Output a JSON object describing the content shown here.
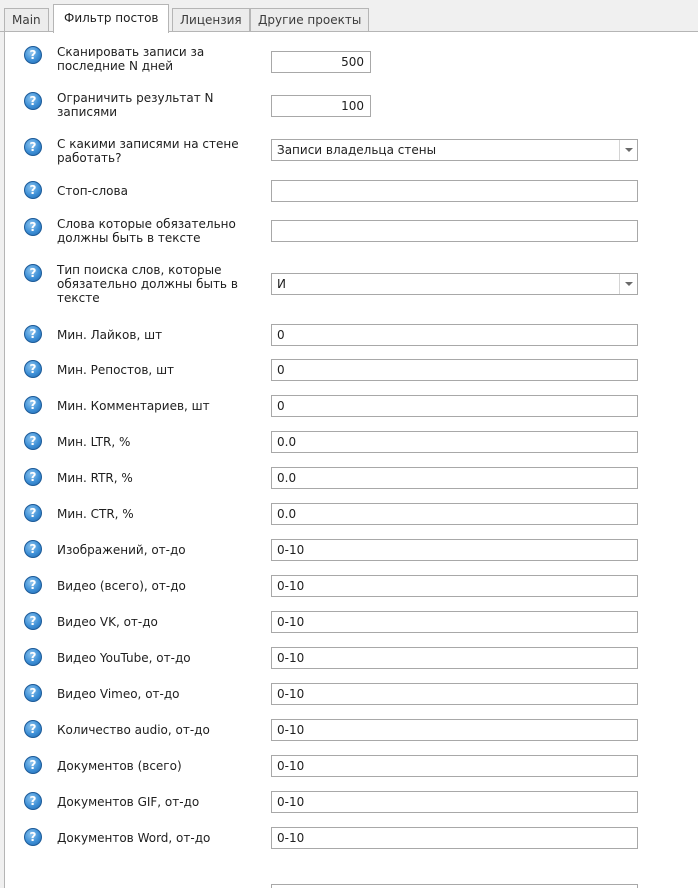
{
  "tabs": [
    {
      "label": "Main"
    },
    {
      "label": "Фильтр постов"
    },
    {
      "label": "Лицензия"
    },
    {
      "label": "Другие проекты"
    }
  ],
  "help_glyph": "?",
  "fields": {
    "scan_days": {
      "label": "Сканировать записи за последние N дней",
      "value": "500"
    },
    "limit_results": {
      "label": "Ограничить результат N записями",
      "value": "100"
    },
    "wall_posts": {
      "label": "С какими записями на стене работать?",
      "value": "Записи владельца стены"
    },
    "stop_words": {
      "label": "Стоп-слова",
      "value": ""
    },
    "required_words": {
      "label": "Слова которые обязательно должны быть в тексте",
      "value": ""
    },
    "search_type": {
      "label": "Тип поиска слов, которые обязательно должны быть в тексте",
      "value": "И"
    },
    "min_likes": {
      "label": "Мин. Лайков, шт",
      "value": "0"
    },
    "min_reposts": {
      "label": "Мин. Репостов, шт",
      "value": "0"
    },
    "min_comments": {
      "label": "Мин. Комментариев, шт",
      "value": "0"
    },
    "min_ltr": {
      "label": "Мин. LTR, %",
      "value": "0.0"
    },
    "min_rtr": {
      "label": "Мин. RTR, %",
      "value": "0.0"
    },
    "min_ctr": {
      "label": "Мин. CTR, %",
      "value": "0.0"
    },
    "images": {
      "label": "Изображений, от-до",
      "value": "0-10"
    },
    "video_total": {
      "label": "Видео (всего), от-до",
      "value": "0-10"
    },
    "video_vk": {
      "label": "Видео VK,  от-до",
      "value": "0-10"
    },
    "video_youtube": {
      "label": "Видео YouTube, от-до",
      "value": "0-10"
    },
    "video_vimeo": {
      "label": "Видео Vimeo, от-до",
      "value": "0-10"
    },
    "audio_count": {
      "label": "Количество audio, от-до",
      "value": "0-10"
    },
    "documents_total": {
      "label": "Документов (всего)",
      "value": "0-10"
    },
    "documents_gif": {
      "label": "Документов GIF, от-до",
      "value": "0-10"
    },
    "documents_word": {
      "label": "Документов Word, от-до",
      "value": "0-10"
    }
  },
  "colors": {
    "help_icon": "#3d8fd6",
    "panel_bg": "#ffffff",
    "window_bg": "#f0f0f0"
  }
}
